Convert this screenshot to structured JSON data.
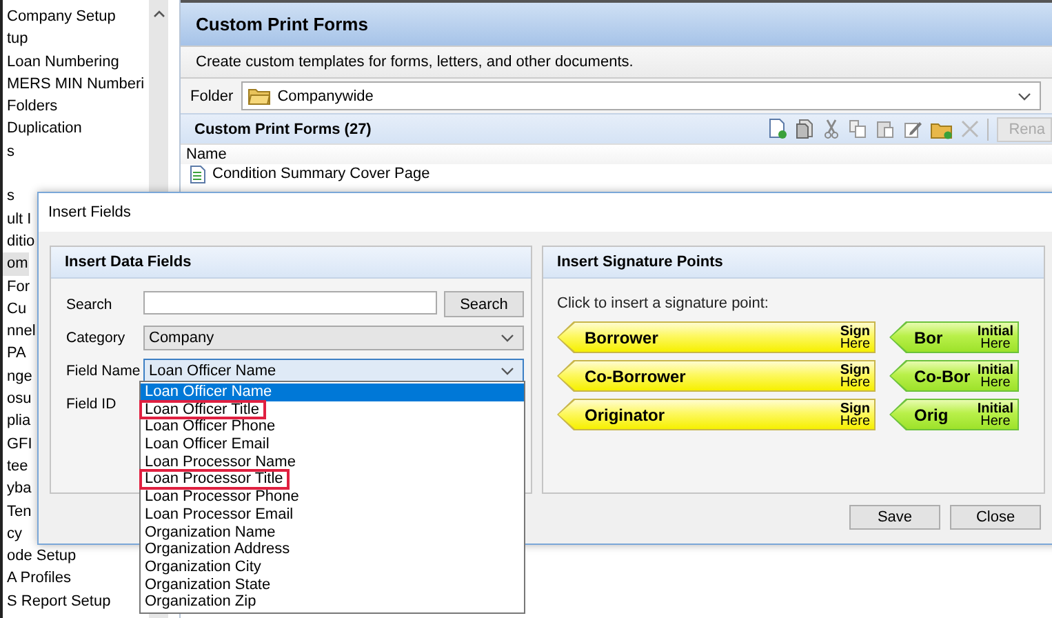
{
  "sidebar": {
    "items": [
      {
        "label": "Company Setup",
        "selected": false
      },
      {
        "label": "tup",
        "selected": false
      },
      {
        "label": "Loan Numbering",
        "selected": false
      },
      {
        "label": "MERS MIN Numberi",
        "selected": false
      },
      {
        "label": "Folders",
        "selected": false
      },
      {
        "label": "Duplication",
        "selected": false
      },
      {
        "label": "s",
        "selected": false
      },
      {
        "label": "s",
        "selected": false,
        "gap_before": true
      },
      {
        "label": "ult I",
        "selected": false
      },
      {
        "label": "ditio",
        "selected": false
      },
      {
        "label": "om",
        "selected": true
      },
      {
        "label": "For",
        "selected": false
      },
      {
        "label": "Cu",
        "selected": false
      },
      {
        "label": "nnel",
        "selected": false
      },
      {
        "label": "PA",
        "selected": false
      },
      {
        "label": "nge",
        "selected": false
      },
      {
        "label": "osu",
        "selected": false
      },
      {
        "label": "plia",
        "selected": false
      },
      {
        "label": "GFI",
        "selected": false
      },
      {
        "label": "tee",
        "selected": false
      },
      {
        "label": "yba",
        "selected": false
      },
      {
        "label": "Ten",
        "selected": false
      },
      {
        "label": "cy",
        "selected": false
      },
      {
        "label": "ode Setup",
        "selected": false
      },
      {
        "label": "A Profiles",
        "selected": false
      },
      {
        "label": "S Report Setup",
        "selected": false
      }
    ]
  },
  "main": {
    "title": "Custom Print Forms",
    "description": "Create custom templates for forms, letters, and other documents.",
    "folder": {
      "label": "Folder",
      "value": "Companywide"
    },
    "list": {
      "title": "Custom Print Forms (27)",
      "rename_button": {
        "label": "Rena",
        "disabled": true
      },
      "column": "Name",
      "rows": [
        "Condition Summary Cover Page"
      ]
    }
  },
  "dialog": {
    "title": "Insert Fields",
    "data_fields": {
      "title": "Insert Data Fields",
      "search_label": "Search",
      "search_button": "Search",
      "category_label": "Category",
      "category_value": "Company",
      "field_name_label": "Field Name",
      "field_name_value": "Loan Officer Name",
      "field_id_label": "Field ID",
      "options": [
        {
          "label": "Loan Officer Name",
          "selected": true,
          "highlighted": false
        },
        {
          "label": "Loan Officer Title",
          "selected": false,
          "highlighted": true
        },
        {
          "label": "Loan Officer Phone",
          "selected": false,
          "highlighted": false
        },
        {
          "label": "Loan Officer Email",
          "selected": false,
          "highlighted": false
        },
        {
          "label": "Loan Processor Name",
          "selected": false,
          "highlighted": false
        },
        {
          "label": "Loan Processor Title",
          "selected": false,
          "highlighted": true
        },
        {
          "label": "Loan Processor Phone",
          "selected": false,
          "highlighted": false
        },
        {
          "label": "Loan Processor Email",
          "selected": false,
          "highlighted": false
        },
        {
          "label": "Organization Name",
          "selected": false,
          "highlighted": false
        },
        {
          "label": "Organization Address",
          "selected": false,
          "highlighted": false
        },
        {
          "label": "Organization City",
          "selected": false,
          "highlighted": false
        },
        {
          "label": "Organization State",
          "selected": false,
          "highlighted": false
        },
        {
          "label": "Organization Zip",
          "selected": false,
          "highlighted": false
        }
      ]
    },
    "signature": {
      "title": "Insert Signature Points",
      "hint": "Click to insert a signature point:",
      "points": [
        {
          "kind": "sign",
          "label": "Borrower",
          "tag_top": "Sign",
          "tag_bottom": "Here"
        },
        {
          "kind": "initial",
          "label": "Bor",
          "tag_top": "Initial",
          "tag_bottom": "Here"
        },
        {
          "kind": "sign",
          "label": "Co-Borrower",
          "tag_top": "Sign",
          "tag_bottom": "Here"
        },
        {
          "kind": "initial",
          "label": "Co-Bor",
          "tag_top": "Initial",
          "tag_bottom": "Here"
        },
        {
          "kind": "sign",
          "label": "Originator",
          "tag_top": "Sign",
          "tag_bottom": "Here"
        },
        {
          "kind": "initial",
          "label": "Orig",
          "tag_top": "Initial",
          "tag_bottom": "Here"
        }
      ]
    },
    "buttons": [
      "Save",
      "Close"
    ]
  }
}
